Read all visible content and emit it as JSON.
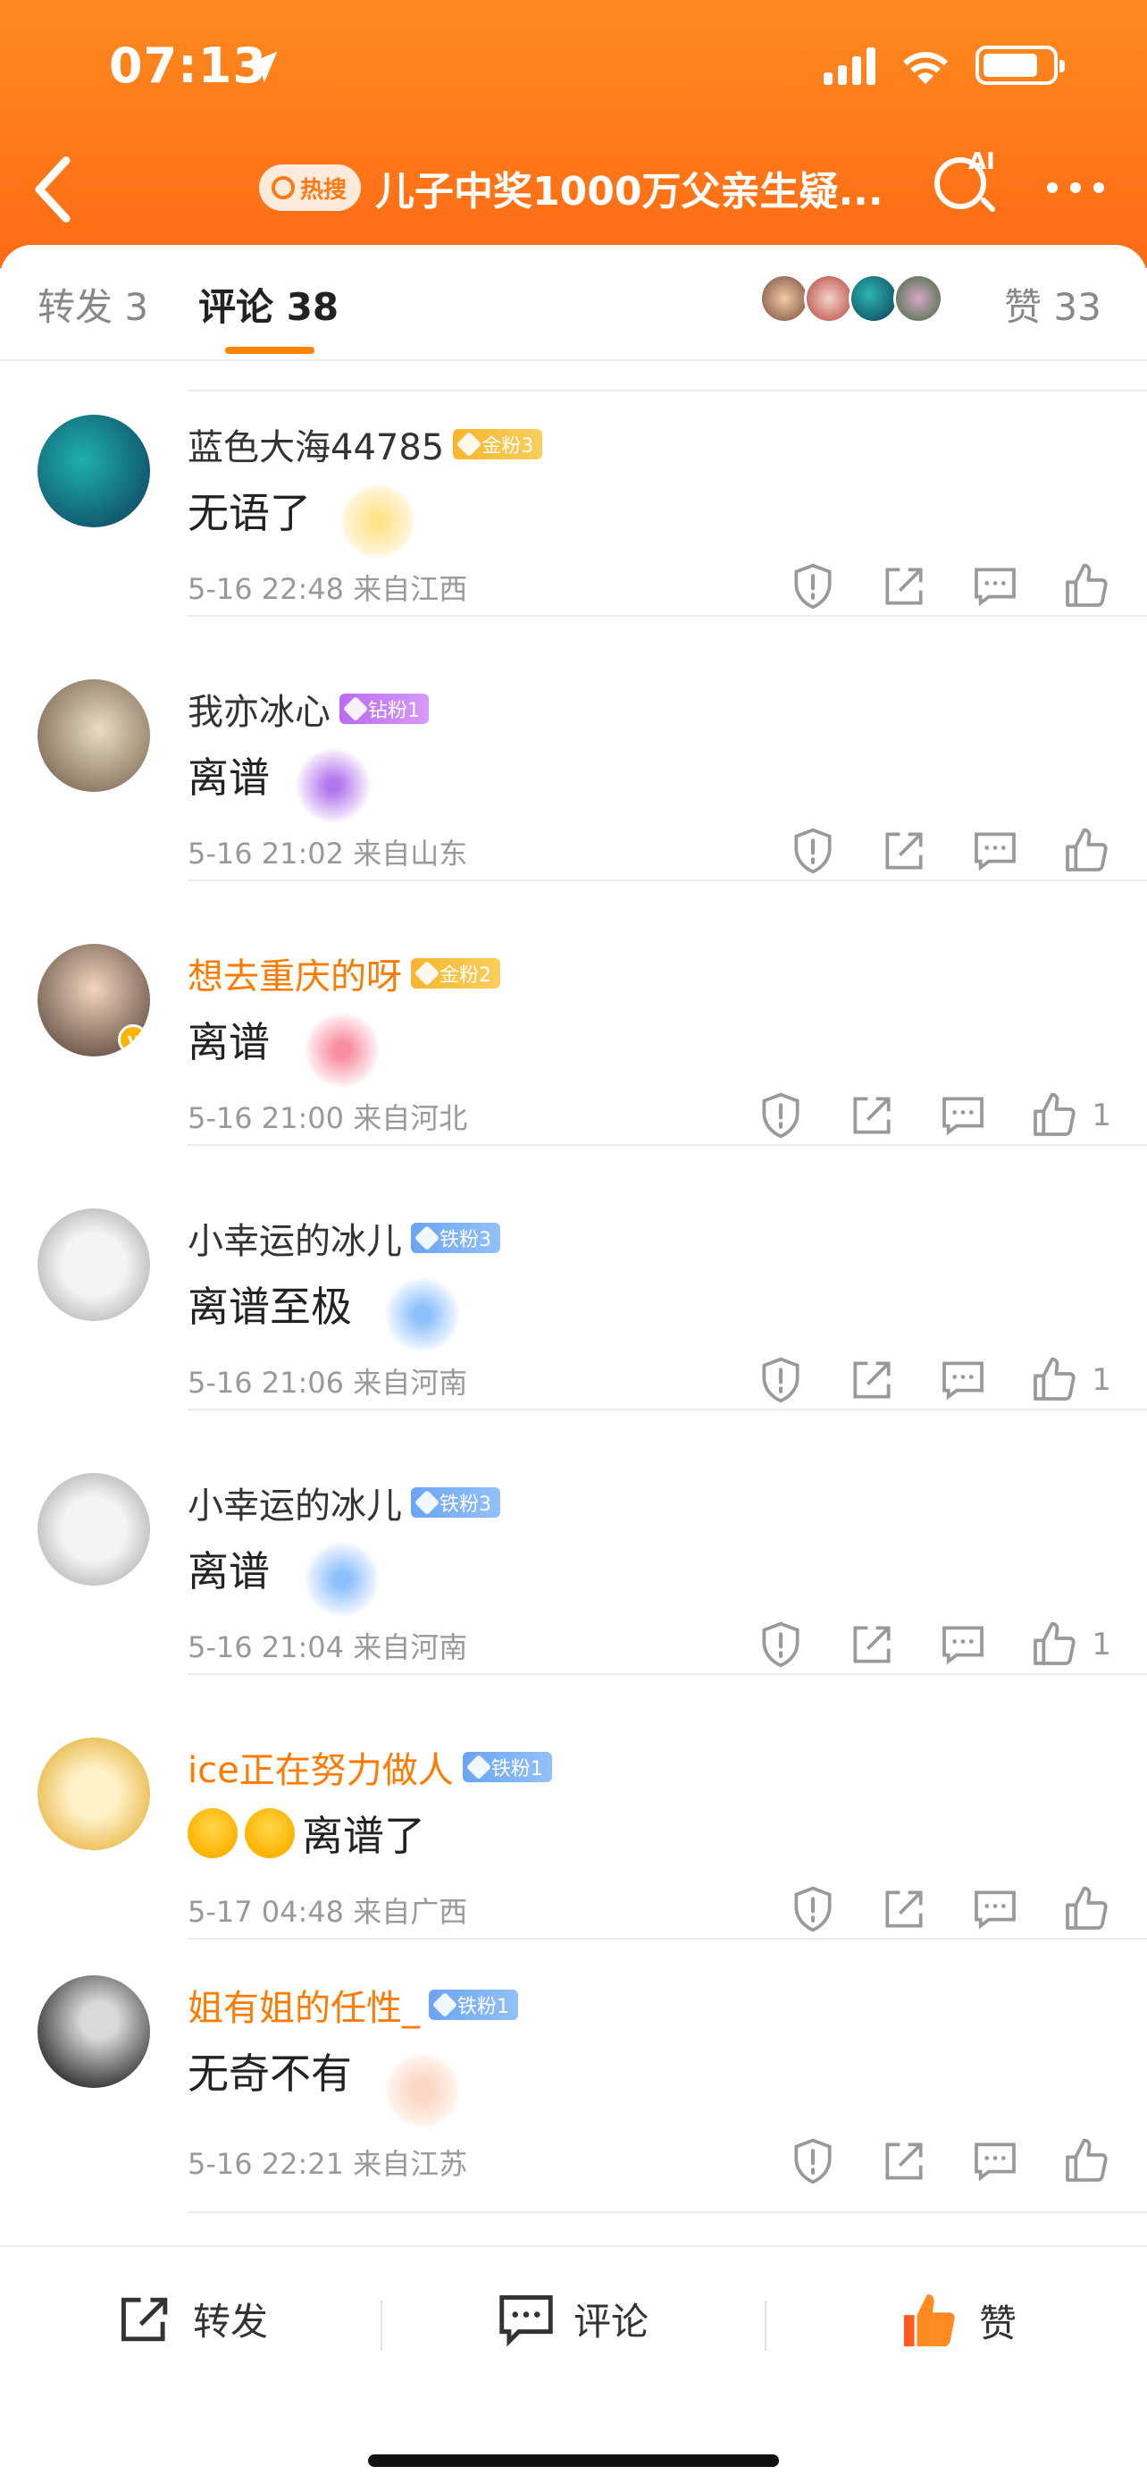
{
  "status_bar": {
    "time": "07:13"
  },
  "nav": {
    "hot_label": "热搜",
    "title": "儿子中奖1000万父亲生疑...",
    "ai_label": "AI"
  },
  "tabs": {
    "repost": "转发 3",
    "comments": "评论 38",
    "likes": "赞 33"
  },
  "comments": [
    {
      "name": "蓝色大海44785",
      "name_color": "#333333",
      "fan_label": "金粉3",
      "fan_type": "gold",
      "text": "无语了",
      "time": "5-16 22:48 来自江西",
      "likes": ""
    },
    {
      "name": "我亦冰心",
      "name_color": "#333333",
      "fan_label": "钻粉1",
      "fan_type": "diamond",
      "text": "离谱",
      "time": "5-16 21:02 来自山东",
      "likes": ""
    },
    {
      "name": "想去重庆的呀",
      "name_color": "#ff7a00",
      "fan_label": "金粉2",
      "fan_type": "gold",
      "text": "离谱",
      "time": "5-16 21:00 来自河北",
      "likes": "1"
    },
    {
      "name": "小幸运的冰儿",
      "name_color": "#333333",
      "fan_label": "铁粉3",
      "fan_type": "iron",
      "text": "离谱至极",
      "time": "5-16 21:06 来自河南",
      "likes": "1"
    },
    {
      "name": "小幸运的冰儿",
      "name_color": "#333333",
      "fan_label": "铁粉3",
      "fan_type": "iron",
      "text": "离谱",
      "time": "5-16 21:04 来自河南",
      "likes": "1"
    },
    {
      "name": "ice正在努力做人",
      "name_color": "#ff7a00",
      "fan_label": "铁粉1",
      "fan_type": "iron",
      "text": "离谱了",
      "time": "5-17 04:48 来自广西",
      "likes": ""
    },
    {
      "name": "姐有姐的任性_",
      "name_color": "#ff7a00",
      "fan_label": "铁粉1",
      "fan_type": "iron",
      "text": "无奇不有",
      "time": "5-16 22:21 来自江苏",
      "likes": ""
    }
  ],
  "bottom_bar": {
    "repost": "转发",
    "comment": "评论",
    "like": "赞"
  },
  "colors": {
    "accent": "#ff8200",
    "header_bg": "#ff7a18"
  }
}
